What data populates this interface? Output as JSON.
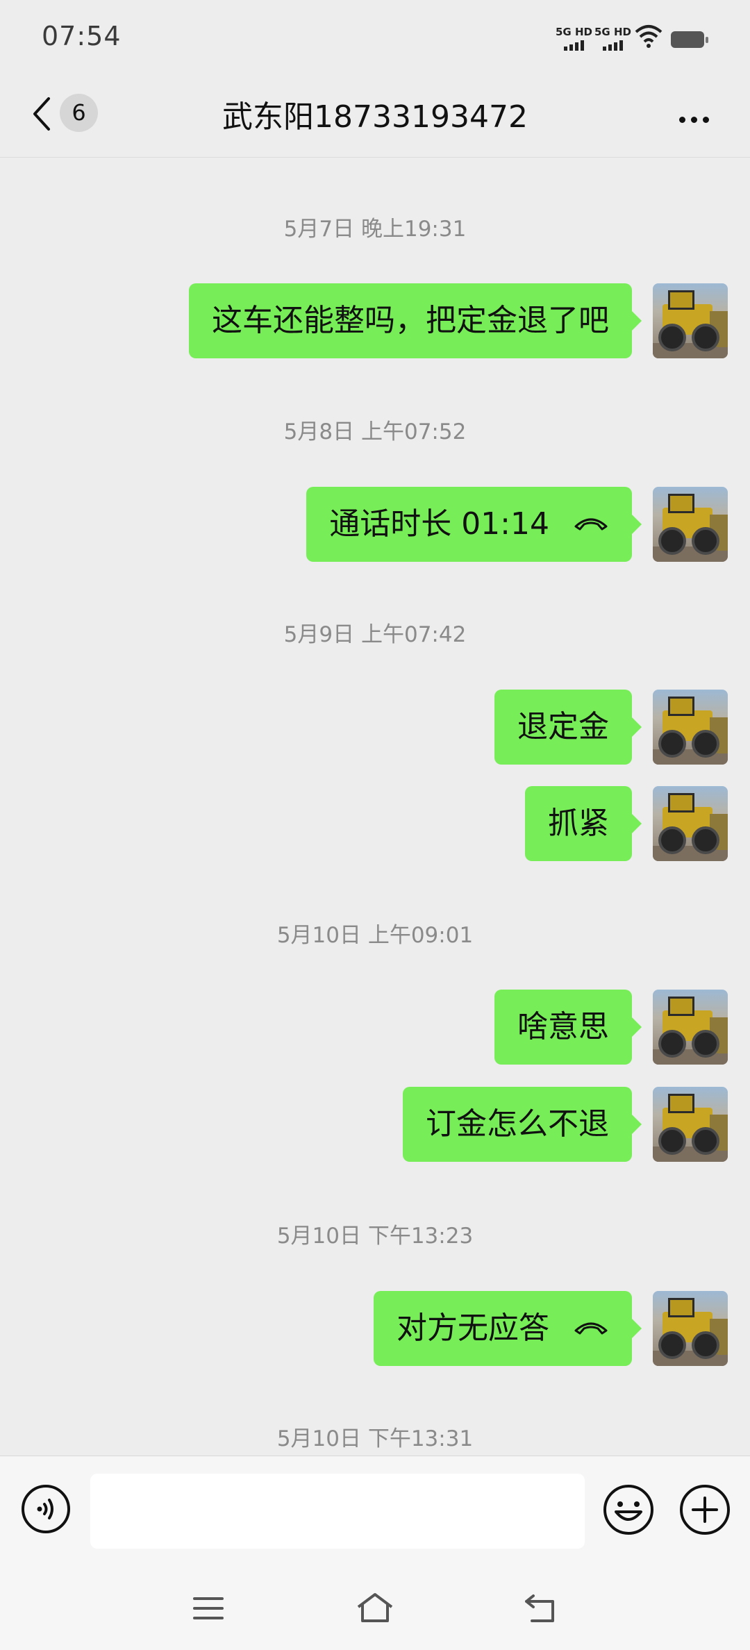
{
  "status_bar": {
    "time": "07:54",
    "sim1": "5G HD",
    "sim2": "5G HD"
  },
  "header": {
    "unread_count": "6",
    "title": "武东阳18733193472"
  },
  "messages": [
    {
      "type": "timestamp",
      "text": "5月7日 晚上19:31"
    },
    {
      "type": "text",
      "side": "right",
      "text": "这车还能整吗，把定金退了吧"
    },
    {
      "type": "timestamp",
      "text": "5月8日 上午07:52"
    },
    {
      "type": "call",
      "side": "right",
      "text": "通话时长 01:14"
    },
    {
      "type": "timestamp",
      "text": "5月9日 上午07:42"
    },
    {
      "type": "text",
      "side": "right",
      "text": "退定金"
    },
    {
      "type": "text",
      "side": "right",
      "text": "抓紧"
    },
    {
      "type": "timestamp",
      "text": "5月10日 上午09:01"
    },
    {
      "type": "text",
      "side": "right",
      "text": "啥意思"
    },
    {
      "type": "text",
      "side": "right",
      "text": "订金怎么不退"
    },
    {
      "type": "timestamp",
      "text": "5月10日 下午13:23"
    },
    {
      "type": "call",
      "side": "right",
      "text": "对方无应答"
    },
    {
      "type": "timestamp",
      "text": "5月10日 下午13:31"
    }
  ],
  "input": {
    "value": ""
  },
  "icons": {
    "back": "chevron-left-icon",
    "more": "more-dots-icon",
    "voice": "voice-icon",
    "emoji": "emoji-icon",
    "plus": "plus-icon",
    "call": "phone-hangup-icon",
    "nav_menu": "menu-icon",
    "nav_home": "home-icon",
    "nav_back": "back-icon"
  },
  "colors": {
    "bubble": "#77ee58",
    "background": "#ededed"
  }
}
